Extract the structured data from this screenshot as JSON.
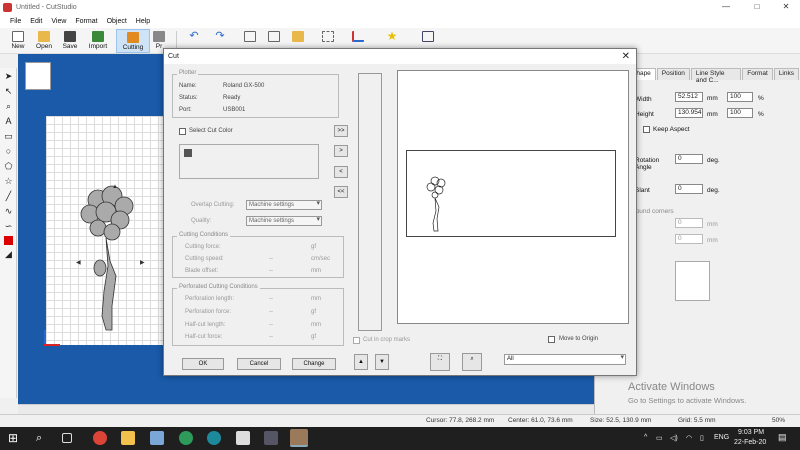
{
  "window": {
    "title": "Untitled - CutStudio",
    "minimize": "—",
    "maximize": "□",
    "close": "✕"
  },
  "menu": [
    "File",
    "Edit",
    "View",
    "Format",
    "Object",
    "Help"
  ],
  "toolbar": {
    "new": "New",
    "open": "Open",
    "save": "Save",
    "import": "Import",
    "cutting": "Cutting",
    "properties": "Pr"
  },
  "dialog": {
    "title": "Cut",
    "plotter_group": "Plotter",
    "name_label": "Name:",
    "name_value": "Roland GX-500",
    "status_label": "Status:",
    "status_value": "Ready",
    "port_label": "Port:",
    "port_value": "USB001",
    "select_cut_color": "Select Cut Color",
    "move_all_right": ">>",
    "move_right": ">",
    "move_left": "<",
    "move_all_left": "<<",
    "overlap_label": "Overlap Cutting:",
    "overlap_value": "Machine settings",
    "quality_label": "Quality:",
    "quality_value": "Machine settings",
    "cutting_conditions": "Cutting Conditions",
    "cutting_force_label": "Cutting force:",
    "cutting_force_unit": "gf",
    "cutting_speed_label": "Cutting speed:",
    "cutting_speed_dash": "--",
    "cutting_speed_unit": "cm/sec",
    "blade_offset_label": "Blade offset:",
    "blade_offset_dash": "--",
    "blade_offset_unit": "mm",
    "perforated_conditions": "Perforated Cutting Conditions",
    "perf_length_label": "Perforation length:",
    "perf_length_dash": "--",
    "perf_length_unit": "mm",
    "perf_force_label": "Perforation force:",
    "perf_force_dash": "--",
    "perf_force_unit": "gf",
    "halfcut_length_label": "Half-cut length:",
    "halfcut_length_dash": "--",
    "halfcut_length_unit": "mm",
    "halfcut_force_label": "Half-cut force:",
    "halfcut_force_dash": "--",
    "halfcut_force_unit": "gf",
    "cut_crop_marks": "Cut in crop marks",
    "move_to_origin": "Move to Origin",
    "view_select": "All",
    "ok": "OK",
    "cancel": "Cancel",
    "change": "Change"
  },
  "properties": {
    "tabs": [
      "Shape",
      "Position",
      "Line Style and C...",
      "Format",
      "Links"
    ],
    "width_label": "Width",
    "width_value": "52.512",
    "width_unit": "mm",
    "width_pct": "100",
    "width_pct_unit": "%",
    "height_label": "Height",
    "height_value": "130.954",
    "height_unit": "mm",
    "height_pct": "100",
    "height_pct_unit": "%",
    "keep_aspect": "Keep Aspect",
    "rotation_label": "Rotation Angle",
    "rotation_value": "0",
    "rotation_unit": "deg.",
    "slant_label": "Slant",
    "slant_value": "0",
    "slant_unit": "deg.",
    "round_corners": "Round corners",
    "round_a": "0",
    "round_b": "0",
    "round_unit": "mm"
  },
  "status": {
    "cursor": "Cursor: 77.8, 268.2 mm",
    "center": "Center: 61.0, 73.6 mm",
    "size": "Size: 52.5, 130.9 mm",
    "grid": "Grid: 5.5 mm",
    "zoom": "50%"
  },
  "watermark": {
    "line1": "Activate Windows",
    "line2": "Go to Settings to activate Windows."
  },
  "taskbar": {
    "lang": "ENG",
    "time": "9:03 PM",
    "date": "22-Feb-20"
  }
}
